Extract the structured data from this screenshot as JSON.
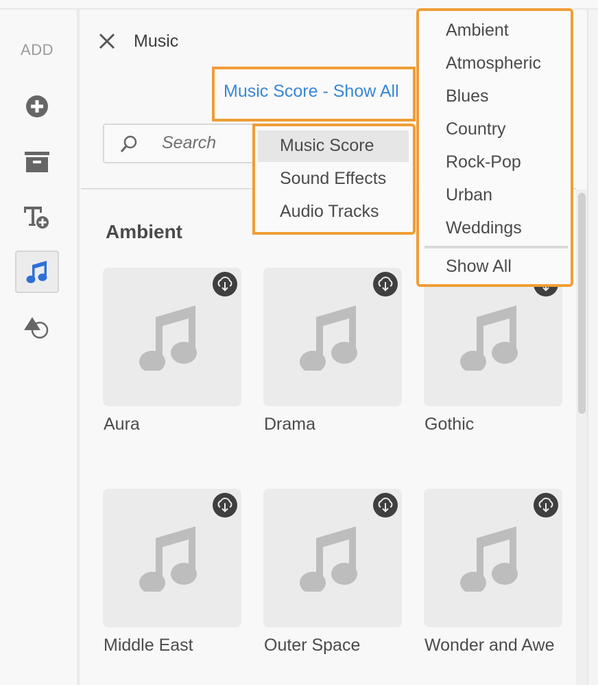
{
  "sidebar": {
    "heading": "ADD",
    "items": [
      {
        "name": "add-media",
        "icon": "plus-circle-icon",
        "active": false
      },
      {
        "name": "add-container",
        "icon": "archive-box-icon",
        "active": false
      },
      {
        "name": "add-text",
        "icon": "text-add-icon",
        "active": false
      },
      {
        "name": "add-music",
        "icon": "music-note-icon",
        "active": true
      },
      {
        "name": "add-shapes",
        "icon": "shapes-icon",
        "active": false
      }
    ]
  },
  "panel": {
    "title": "Music",
    "close_icon": "close-icon",
    "filter_link": "Music Score - Show All",
    "search": {
      "placeholder": "Search",
      "value": ""
    },
    "section_title": "Ambient"
  },
  "type_menu": {
    "items": [
      {
        "label": "Music Score",
        "selected": true
      },
      {
        "label": "Sound Effects",
        "selected": false
      },
      {
        "label": "Audio Tracks",
        "selected": false
      }
    ]
  },
  "category_menu": {
    "items": [
      "Ambient",
      "Atmospheric",
      "Blues",
      "Country",
      "Rock-Pop",
      "Urban",
      "Weddings"
    ],
    "show_all": "Show All"
  },
  "tracks": [
    {
      "title": "Aura",
      "icon": "cloud-download-icon"
    },
    {
      "title": "Drama",
      "icon": "cloud-download-icon"
    },
    {
      "title": "Gothic",
      "icon": "cloud-download-icon"
    },
    {
      "title": "Middle East",
      "icon": "cloud-download-icon"
    },
    {
      "title": "Outer Space",
      "icon": "cloud-download-icon"
    },
    {
      "title": "Wonder and Awe",
      "icon": "cloud-download-icon"
    }
  ],
  "colors": {
    "highlight_border": "#f09d37",
    "link": "#3a86d4",
    "active_icon": "#2f6fd6"
  }
}
